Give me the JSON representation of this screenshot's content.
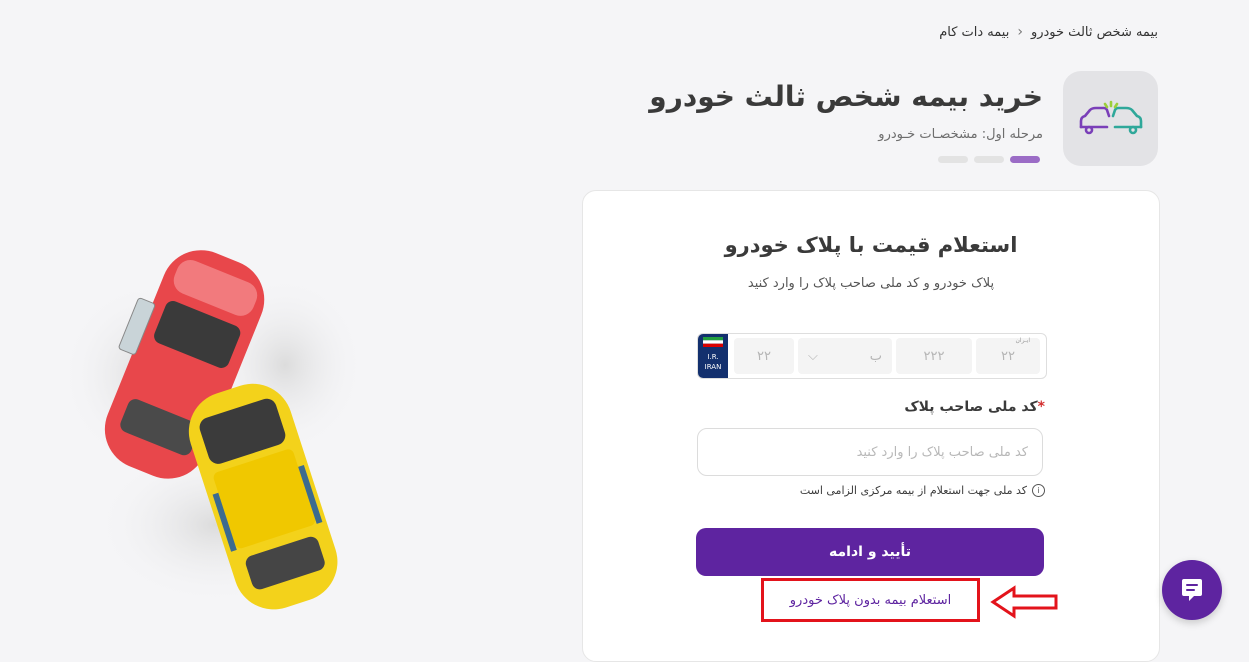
{
  "breadcrumb": {
    "home": "بیمه دات کام",
    "current": "بیمه شخص ثالث خودرو"
  },
  "header": {
    "title": "خرید بیمه شخص ثالث خودرو",
    "step_label": "مرحله اول: مشخصـات خـودرو",
    "steps_total": 3,
    "step_current": 1,
    "icon": "car-collision-icon"
  },
  "form": {
    "title": "استعلام قیمت با پلاک خودرو",
    "subtitle": "پلاک خودرو و کد ملی صاحب پلاک را وارد کنید",
    "plate": {
      "flag_top": "I.R.",
      "flag_bottom": "IRAN",
      "cell_caption": "ایـران",
      "field1_placeholder": "۲۲",
      "field2_placeholder": "۲۲۲",
      "letter_placeholder": "ب",
      "field3_placeholder": "۲۲"
    },
    "national_id": {
      "label": "کد ملی صاحب پلاک",
      "required_mark": "*",
      "placeholder": "کد ملی صاحب پلاک را وارد کنید",
      "value": ""
    },
    "hint": "کد ملی جهت استعلام از بیمه مرکزی الزامی است",
    "submit_label": "تأیید و ادامه",
    "alt_link_label": "استعلام بیمه بدون پلاک خودرو"
  },
  "colors": {
    "primary": "#5e24a0",
    "progress_active": "#9b6cc6",
    "annotation_red": "#e3131b",
    "background": "#f5f5f7"
  },
  "chat": {
    "icon": "chat-icon"
  }
}
